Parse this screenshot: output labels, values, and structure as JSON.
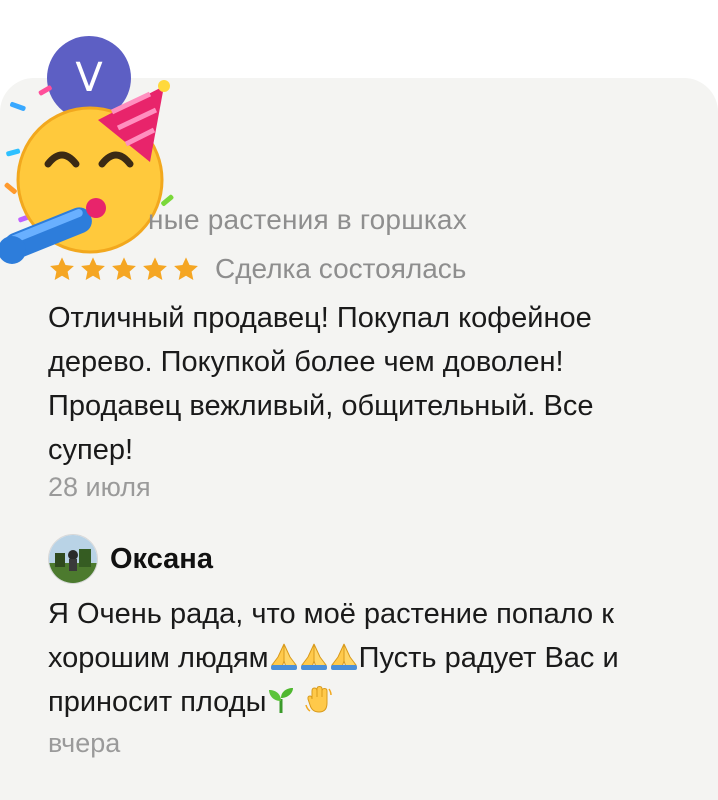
{
  "review": {
    "avatar_letter": "V",
    "category_text": "ные растения в горшках",
    "rating": 5,
    "deal_status": "Сделка состоялась",
    "text": "Отличный продавец! Покупал кофейное дерево. Покупкой более чем доволен! Продавец вежливый, общительный. Все супер!",
    "date": "28 июля"
  },
  "reply": {
    "author": "Оксана",
    "text_part1": "Я Очень рада, что моё растение попало к хорошим людям",
    "text_part2": "Пусть радует Вас и приносит плоды",
    "date": "вчера"
  },
  "icons": {
    "emoji_overlay": "party-face-icon",
    "star": "star-icon",
    "pray": "praying-hands-icon",
    "seedling": "seedling-icon",
    "wave": "waving-hand-icon"
  },
  "colors": {
    "card_bg": "#f4f4f2",
    "avatar_bg": "#5d5fc4",
    "star": "#f5a623",
    "muted_text": "#8e8e8e"
  }
}
